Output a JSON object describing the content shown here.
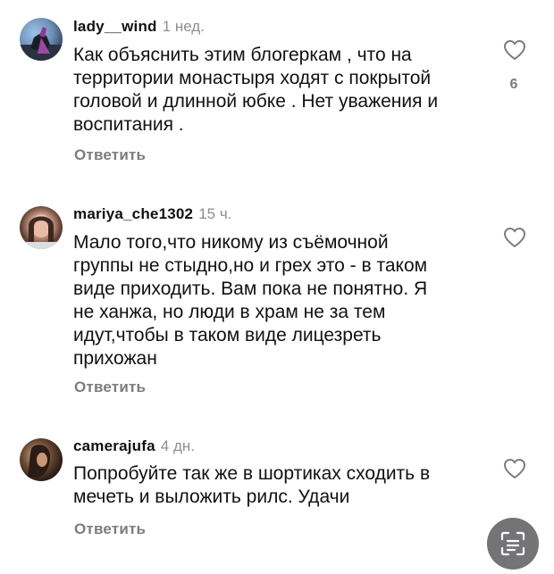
{
  "comments": [
    {
      "username": "lady__wind",
      "time": "1 нед.",
      "text": "Как объяснить этим блогеркам , что на\nтерритории монастыря ходят с покрытой\nголовой и длинной юбке . Нет уважения и\nвоспитания .",
      "likes": "6",
      "reply_label": "Ответить"
    },
    {
      "username": "mariya_che1302",
      "time": "15 ч.",
      "text": "Мало того,что никому из съёмочной\nгруппы не стыдно,но и грех это - в таком\nвиде приходить. Вам пока не понятно. Я\nне ханжа, но люди в храм не за тем\nидут,чтобы в таком виде лицезреть\nприхожан",
      "reply_label": "Ответить"
    },
    {
      "username": "camerajufa",
      "time": "4 дн.",
      "text": "Попробуйте так же в шортиках сходить в\nмечеть и выложить рилс. Удачи",
      "reply_label": "Ответить"
    }
  ],
  "icons": {
    "like": "heart-outline-icon",
    "scan": "text-scan-icon"
  },
  "colors": {
    "text": "#111111",
    "secondary": "#8e8e93",
    "fab": "#747476"
  }
}
